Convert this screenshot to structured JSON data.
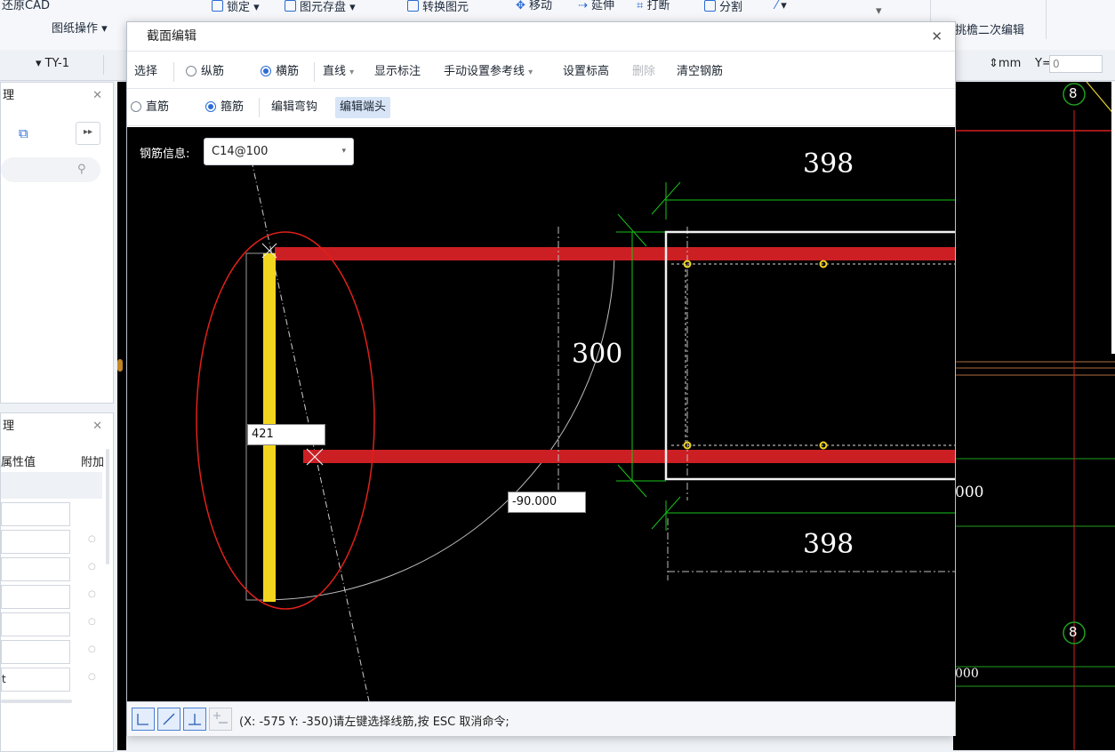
{
  "ribbon": {
    "restore_cad": "还原CAD",
    "drawing_ops": "图纸操作",
    "lock": "锁定",
    "save_element": "图元存盘",
    "convert_element": "转换图元",
    "move": "移动",
    "extend": "延伸",
    "break": "打断",
    "split": "分割",
    "secondary_edit": "挑檐二次编辑",
    "layer_value": "TY-1",
    "unit": "mm",
    "y_label": "Y=",
    "y_value": "0"
  },
  "left_panel_top": {
    "title": "理"
  },
  "left_panel_bottom": {
    "title": "理",
    "col_value": "属性值",
    "col_extra": "附加",
    "last_row_text": "t"
  },
  "dialog": {
    "title": "截面编辑",
    "toolbar1": {
      "select": "选择",
      "longitudinal": "纵筋",
      "transverse": "横筋",
      "line": "直线",
      "show_marks": "显示标注",
      "manual_ref": "手动设置参考线",
      "set_elevation": "设置标高",
      "delete": "删除",
      "clear_rebar": "清空钢筋"
    },
    "toolbar2": {
      "straight": "直筋",
      "stirrup": "箍筋",
      "edit_hook": "编辑弯钩",
      "edit_end": "编辑端头"
    },
    "rebar_info_label": "钢筋信息:",
    "rebar_info_value": "C14@100",
    "dims": {
      "top": "398",
      "mid": "300",
      "bottom": "398"
    },
    "input_length": "421",
    "input_angle": "-90.000",
    "status_text": "(X: -575 Y: -350)请左键选择线筋,按 ESC 取消命令;"
  },
  "cad_right": {
    "dim1": "000",
    "dim2": "000",
    "axis_top": "8",
    "axis_bottom": "8"
  }
}
